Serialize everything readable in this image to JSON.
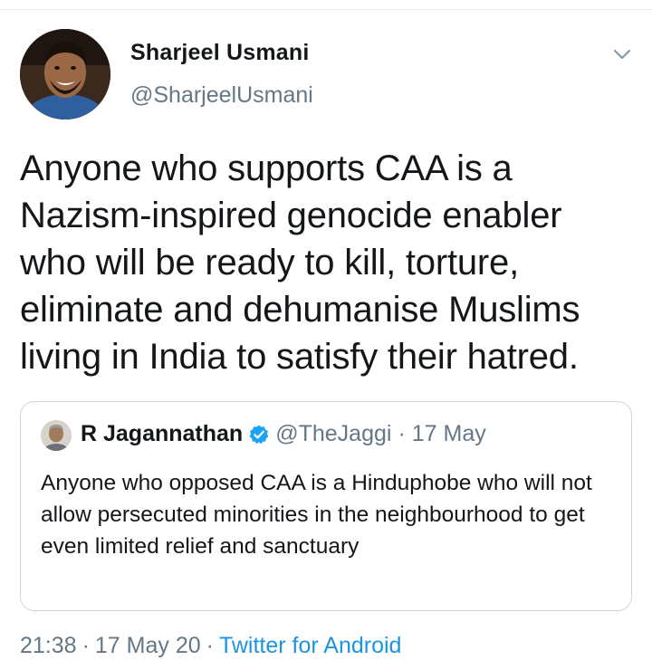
{
  "tweet": {
    "author": {
      "name": "Sharjeel Usmani",
      "handle": "@SharjeelUsmani"
    },
    "text": "Anyone who supports CAA is a Nazism-inspired genocide enabler who will be ready to kill, torture, eliminate and dehumanise Muslims living in India to satisfy their hatred.",
    "menu_icon": "chevron-down-icon",
    "time": "21:38",
    "date": "17 May 20",
    "separator": "·",
    "source": "Twitter for Android"
  },
  "quoted_tweet": {
    "author": {
      "name": "R Jagannathan",
      "verified_icon": "verified-badge-icon",
      "handle": "@TheJaggi"
    },
    "separator": "·",
    "date": "17 May",
    "text": "Anyone who opposed CAA is a Hinduphobe who will not allow persecuted minorities in the neighbourhood to get even limited relief and sanctuary"
  },
  "colors": {
    "text_primary": "#14171a",
    "text_secondary": "#657786",
    "link": "#1b95e0",
    "verified": "#1da1f2",
    "border": "#ccd6dd"
  }
}
